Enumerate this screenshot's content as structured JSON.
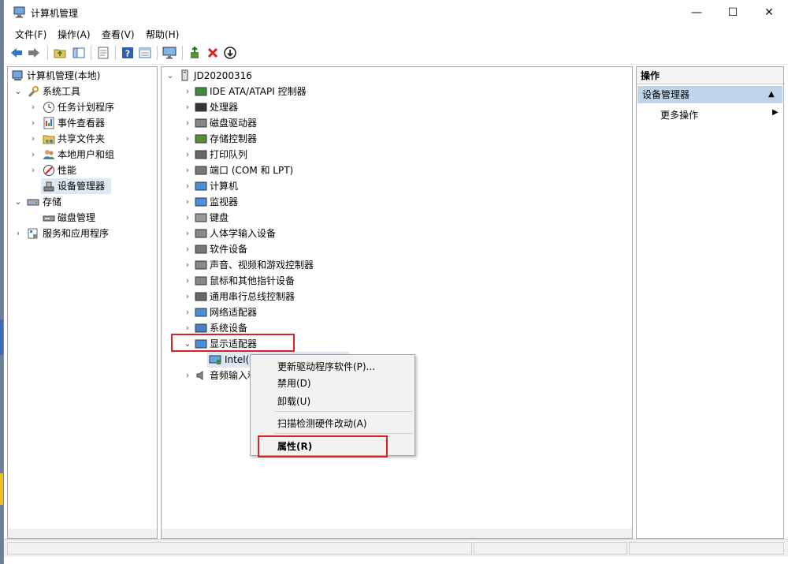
{
  "window": {
    "title": "计算机管理"
  },
  "window_controls": {
    "minimize": "—",
    "maximize": "☐",
    "close": "✕"
  },
  "menu": {
    "items": [
      "文件(F)",
      "操作(A)",
      "查看(V)",
      "帮助(H)"
    ]
  },
  "left_tree": {
    "root": "计算机管理(本地)",
    "system_tools": "系统工具",
    "task_scheduler": "任务计划程序",
    "event_viewer": "事件查看器",
    "shared_folders": "共享文件夹",
    "local_users": "本地用户和组",
    "performance": "性能",
    "device_manager": "设备管理器",
    "storage": "存储",
    "disk_management": "磁盘管理",
    "services": "服务和应用程序"
  },
  "device_tree": {
    "computer": "JD20200316",
    "categories": [
      "IDE ATA/ATAPI 控制器",
      "处理器",
      "磁盘驱动器",
      "存储控制器",
      "打印队列",
      "端口 (COM 和 LPT)",
      "计算机",
      "监视器",
      "键盘",
      "人体学输入设备",
      "软件设备",
      "声音、视频和游戏控制器",
      "鼠标和其他指针设备",
      "通用串行总线控制器",
      "网络适配器",
      "系统设备",
      "显示适配器"
    ],
    "display_child": "Intel(R",
    "audio_inputs": "音频输入和"
  },
  "actions": {
    "header": "操作",
    "group": "设备管理器",
    "more": "更多操作"
  },
  "context_menu": {
    "update_driver": "更新驱动程序软件(P)...",
    "disable": "禁用(D)",
    "uninstall": "卸载(U)",
    "scan": "扫描检测硬件改动(A)",
    "properties": "属性(R)"
  },
  "colors": {
    "highlight_box": "#e02020",
    "selection": "#dce8f4",
    "action_group_bg": "#bfd3e9"
  }
}
